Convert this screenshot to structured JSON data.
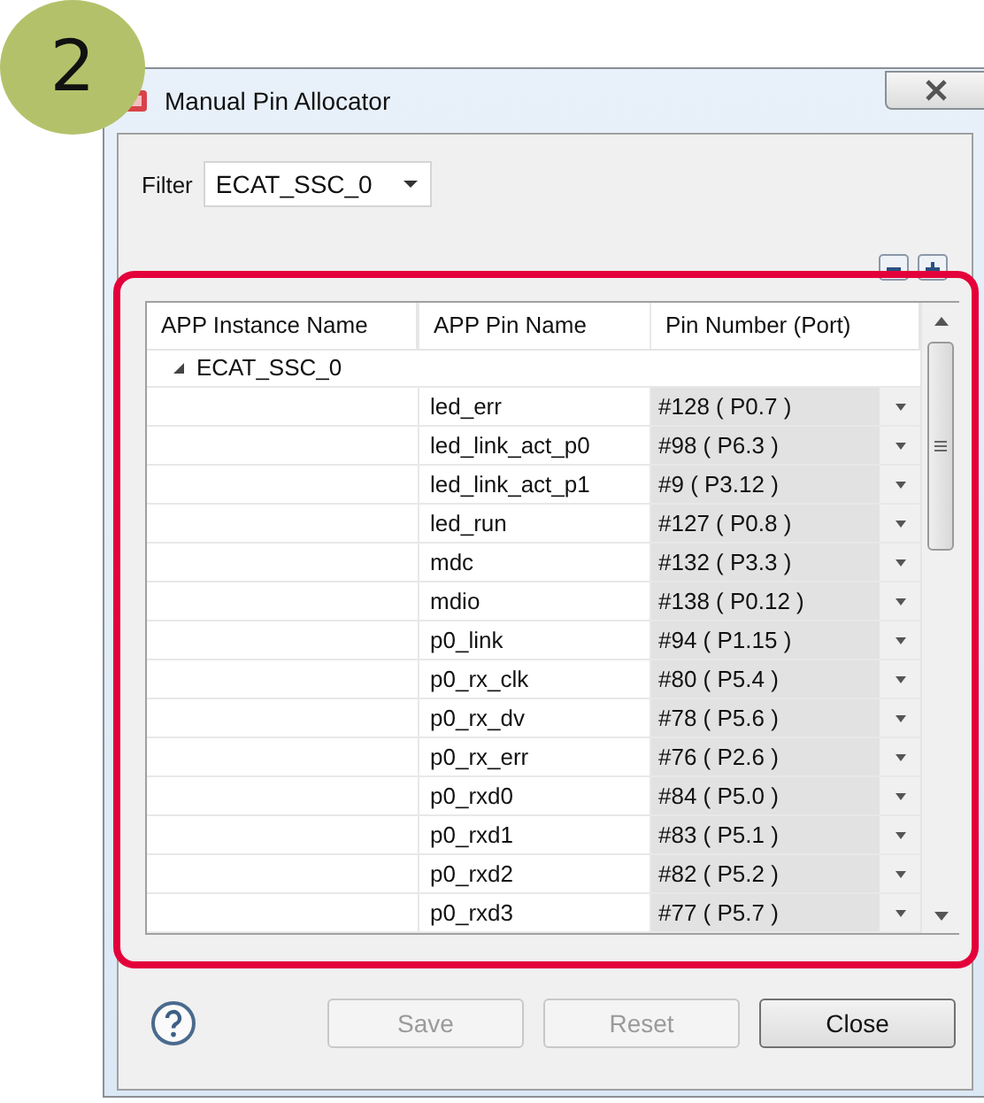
{
  "step_badge": "2",
  "window": {
    "title": "Manual Pin Allocator"
  },
  "filter": {
    "label": "Filter",
    "value": "ECAT_SSC_0"
  },
  "table": {
    "columns": [
      "APP Instance Name",
      "APP Pin Name",
      "Pin Number (Port)"
    ],
    "groups": [
      {
        "name": "ECAT_SSC_0",
        "expanded": true,
        "children": [
          {
            "pin_name": "led_err",
            "pin_number": "#128 ( P0.7 )"
          },
          {
            "pin_name": "led_link_act_p0",
            "pin_number": "#98 ( P6.3 )"
          },
          {
            "pin_name": "led_link_act_p1",
            "pin_number": "#9 ( P3.12 )"
          },
          {
            "pin_name": "led_run",
            "pin_number": "#127 ( P0.8 )"
          },
          {
            "pin_name": "mdc",
            "pin_number": "#132 ( P3.3 )"
          },
          {
            "pin_name": "mdio",
            "pin_number": "#138 ( P0.12 )"
          },
          {
            "pin_name": "p0_link",
            "pin_number": "#94 ( P1.15 )"
          },
          {
            "pin_name": "p0_rx_clk",
            "pin_number": "#80 ( P5.4 )"
          },
          {
            "pin_name": "p0_rx_dv",
            "pin_number": "#78 ( P5.6 )"
          },
          {
            "pin_name": "p0_rx_err",
            "pin_number": "#76 ( P2.6 )"
          },
          {
            "pin_name": "p0_rxd0",
            "pin_number": "#84 ( P5.0 )"
          },
          {
            "pin_name": "p0_rxd1",
            "pin_number": "#83 ( P5.1 )"
          },
          {
            "pin_name": "p0_rxd2",
            "pin_number": "#82 ( P5.2 )"
          },
          {
            "pin_name": "p0_rxd3",
            "pin_number": "#77 ( P5.7 )"
          }
        ]
      }
    ]
  },
  "buttons": [
    {
      "label": "Save",
      "disabled": true
    },
    {
      "label": "Reset",
      "disabled": true
    },
    {
      "label": "Close",
      "disabled": false
    }
  ]
}
